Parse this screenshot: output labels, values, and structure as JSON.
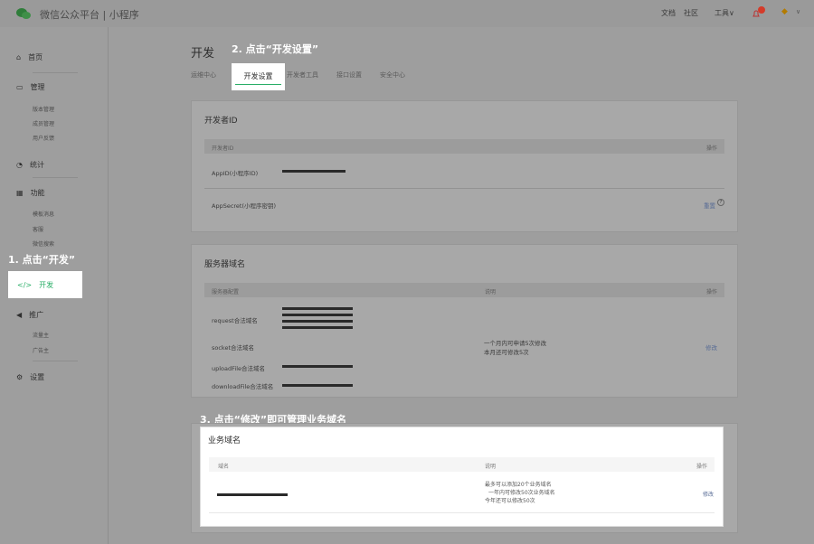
{
  "topbar": {
    "brand": "微信公众平台 | 小程序",
    "links": [
      "文档",
      "社区",
      "工具∨"
    ],
    "bell_badge": "1"
  },
  "sidebar": {
    "home": "首页",
    "manage": "管理",
    "manage_items": [
      "版本管理",
      "成员管理",
      "用户反馈"
    ],
    "stats": "统计",
    "features": "功能",
    "feature_items": [
      "模板消息",
      "客服",
      "微信搜索"
    ],
    "dev": "开发",
    "promo": "推广",
    "promo_items": [
      "流量主",
      "广告主"
    ],
    "settings": "设置"
  },
  "callouts": {
    "step1": "1. 点击“开发”",
    "step2": "2. 点击“开发设置”",
    "step3": "3. 点击“修改”即可管理业务域名"
  },
  "main": {
    "title": "开发",
    "tabs": [
      "运维中心",
      "开发设置",
      "开发者工具",
      "接口设置",
      "安全中心"
    ],
    "active_tab": "开发设置",
    "card1": {
      "title": "开发者ID",
      "head_left": "开发者ID",
      "head_right": "操作",
      "row1": "AppID(小程序ID)",
      "row2": "AppSecret(小程序密钥)",
      "row2_action": "重置"
    },
    "card2": {
      "title": "服务器域名",
      "head_left": "服务器配置",
      "head_mid": "说明",
      "head_right": "操作",
      "rows": [
        "request合法域名",
        "socket合法域名",
        "uploadFile合法域名",
        "downloadFile合法域名"
      ],
      "note1": "一个月内可申请5次修改",
      "note2": "本月还可修改5次",
      "action": "修改"
    },
    "card3": {
      "title": "业务域名",
      "head_left": "域名",
      "head_mid": "说明",
      "head_right": "操作",
      "note1": "最多可以添加20个业务域名",
      "note2": "一年内可修改50次业务域名",
      "note3": "今年还可以修改50次",
      "action": "修改"
    }
  },
  "colors": {
    "accent": "#2aae67",
    "link": "#576b95",
    "overlay": "#9e9e9e"
  }
}
